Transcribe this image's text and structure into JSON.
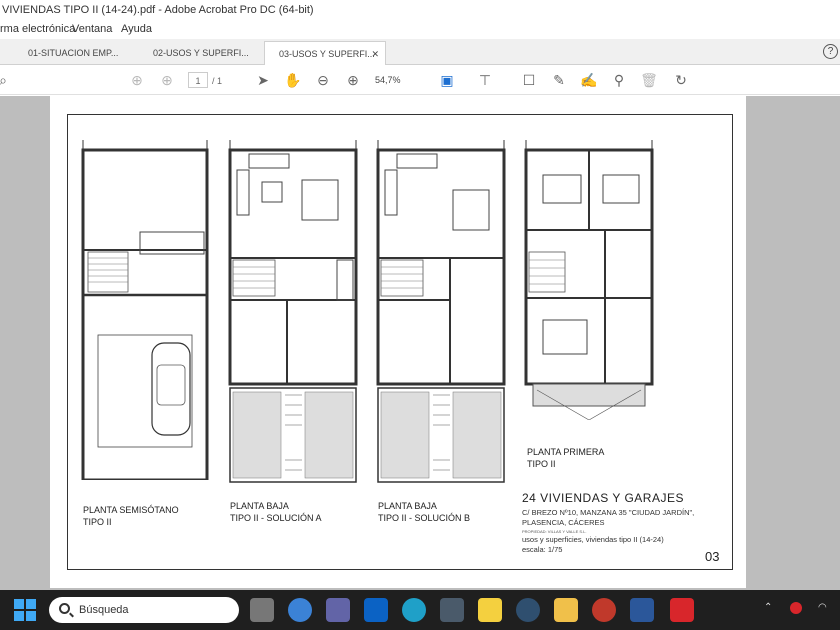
{
  "window": {
    "title": "VIVIENDAS TIPO II (14-24).pdf - Adobe Acrobat Pro DC (64-bit)"
  },
  "menu": {
    "items": [
      "rma electrónica",
      "Ventana",
      "Ayuda"
    ]
  },
  "tabs": [
    {
      "label": "01-SITUACION EMP..."
    },
    {
      "label": "02-USOS Y SUPERFI..."
    },
    {
      "label": "03-USOS Y SUPERFI...",
      "active": true
    }
  ],
  "help": {
    "label": "?"
  },
  "toolbar": {
    "page_current": "1",
    "page_total": "/ 1",
    "zoom": "54,7%"
  },
  "drawing": {
    "plans": [
      {
        "label_line1": "PLANTA SEMISÓTANO",
        "label_line2": "TIPO II"
      },
      {
        "label_line1": "PLANTA BAJA",
        "label_line2": "TIPO II - SOLUCIÓN A"
      },
      {
        "label_line1": "PLANTA BAJA",
        "label_line2": "TIPO II - SOLUCIÓN B"
      },
      {
        "label_line1": "PLANTA PRIMERA",
        "label_line2": "TIPO II"
      }
    ],
    "title_block": {
      "title": "24 VIVIENDAS Y GARAJES",
      "address_line1": "C/ BREZO Nº10, MANZANA 35 \"CIUDAD JARDÍN\",",
      "address_line2": "PLASENCIA, CÁCERES",
      "owner": "PROPIEDAD: VILLAS Y VALLE S.L.",
      "subject": "usos y superficies, viviendas tipo II (14-24)",
      "scale": "escala: 1/75",
      "sheet": "03"
    }
  },
  "taskbar": {
    "search_placeholder": "Búsqueda"
  },
  "colors": {
    "taskbar": "#1f1f1f",
    "doc_background": "#bdbdbd",
    "acrobat_red": "#d8262b",
    "accent_blue": "#1d6fd1"
  }
}
